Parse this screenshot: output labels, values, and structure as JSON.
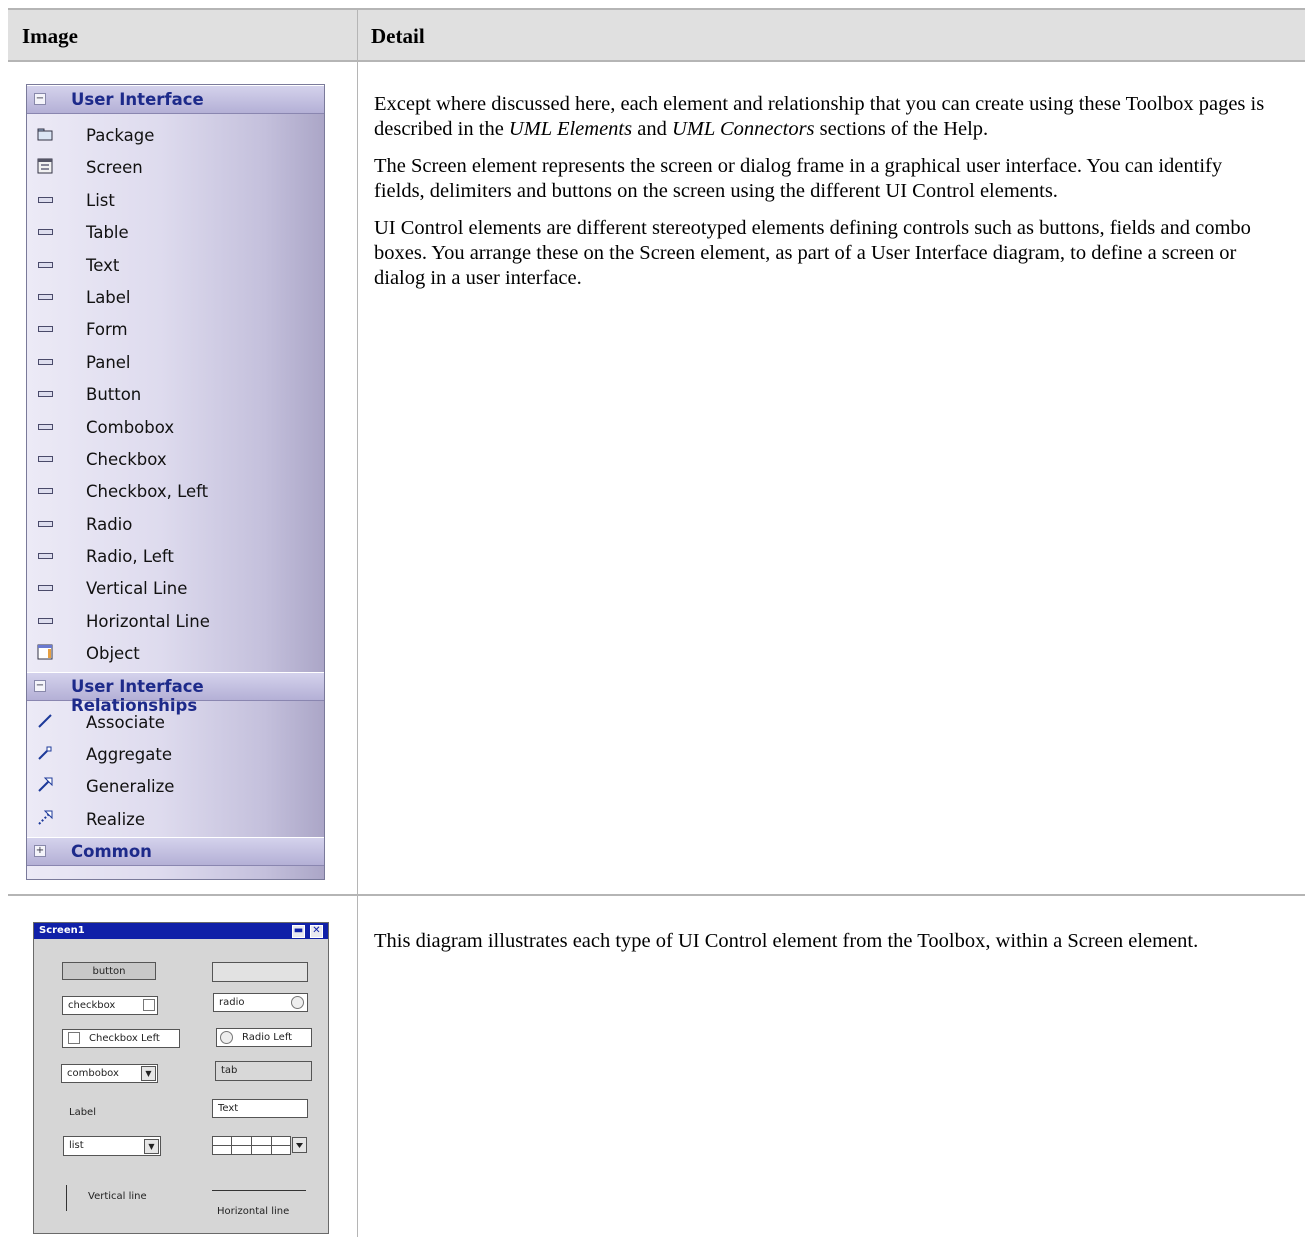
{
  "table": {
    "header": {
      "image_col": "Image",
      "detail_col": "Detail"
    }
  },
  "toolbox": {
    "groups": [
      {
        "label": "User Interface",
        "expander": "−",
        "items": [
          {
            "label": "Package",
            "icon": "package-icon"
          },
          {
            "label": "Screen",
            "icon": "screen-icon"
          },
          {
            "label": "List",
            "icon": "control-icon"
          },
          {
            "label": "Table",
            "icon": "control-icon"
          },
          {
            "label": "Text",
            "icon": "control-icon"
          },
          {
            "label": "Label",
            "icon": "control-icon"
          },
          {
            "label": "Form",
            "icon": "control-icon"
          },
          {
            "label": "Panel",
            "icon": "control-icon"
          },
          {
            "label": "Button",
            "icon": "control-icon"
          },
          {
            "label": "Combobox",
            "icon": "control-icon"
          },
          {
            "label": "Checkbox",
            "icon": "control-icon"
          },
          {
            "label": "Checkbox, Left",
            "icon": "control-icon"
          },
          {
            "label": "Radio",
            "icon": "control-icon"
          },
          {
            "label": "Radio, Left",
            "icon": "control-icon"
          },
          {
            "label": "Vertical Line",
            "icon": "control-icon"
          },
          {
            "label": "Horizontal Line",
            "icon": "control-icon"
          },
          {
            "label": "Object",
            "icon": "object-icon"
          }
        ]
      },
      {
        "label": "User Interface Relationships",
        "expander": "−",
        "items": [
          {
            "label": "Associate",
            "icon": "associate-icon"
          },
          {
            "label": "Aggregate",
            "icon": "aggregate-icon"
          },
          {
            "label": "Generalize",
            "icon": "generalize-icon"
          },
          {
            "label": "Realize",
            "icon": "realize-icon"
          }
        ]
      },
      {
        "label": "Common",
        "expander": "+",
        "items": []
      }
    ]
  },
  "row1": {
    "p1_a": "Except where discussed here, each element and relationship that you can create using these Toolbox pages is described in the ",
    "p1_em1": "UML Elements",
    "p1_b": " and ",
    "p1_em2": "UML Connectors",
    "p1_c": " sections of the Help.",
    "p2": "The Screen element represents the screen or dialog frame in a graphical user interface. You can identify fields, delimiters and buttons on the screen using the different UI Control elements.",
    "p3": "UI Control elements are different stereotyped elements defining controls such as buttons, fields and combo boxes. You arrange these on the Screen element, as part of a User Interface diagram, to define a screen or dialog in a user interface."
  },
  "row2": {
    "p1": "This diagram illustrates each type of UI Control element from the Toolbox, within a Screen element."
  },
  "screen_mock": {
    "title": "Screen1",
    "min_glyph": "▬",
    "close_glyph": "✕",
    "button": "button",
    "checkbox": "checkbox",
    "radio": "radio",
    "checkbox_left": "Checkbox Left",
    "radio_left": "Radio Left",
    "combobox": "combobox",
    "tab": "tab",
    "label": "Label",
    "text": "Text",
    "list": "list",
    "dropdown_glyph": "▼",
    "vertical_line": "Vertical line",
    "horizontal_line": "Horizontal line"
  }
}
